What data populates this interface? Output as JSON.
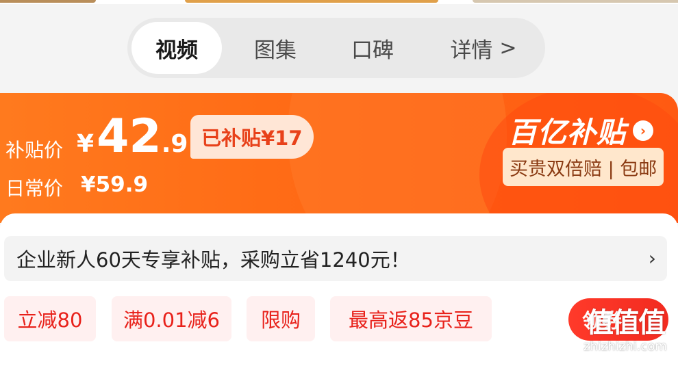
{
  "tabs": [
    {
      "label": "视频",
      "active": true
    },
    {
      "label": "图集",
      "active": false
    },
    {
      "label": "口碑",
      "active": false
    },
    {
      "label": "详情",
      "active": false
    }
  ],
  "tab_more_icon": "chevron-right-icon",
  "price_banner": {
    "subsidy_label": "补贴价",
    "currency": "¥",
    "price_integer": "42",
    "price_decimal": ".9",
    "subsidy_tag": "已补贴¥17",
    "daily_label": "日常价",
    "daily_price": "¥59.9",
    "brand": "百亿补贴",
    "guarantee": "买贵双倍赔 | 包邮",
    "colors": {
      "start": "#ff7a1e",
      "end": "#ff5a12"
    }
  },
  "promo": {
    "text": "企业新人60天专享补贴，采购立省1240元！",
    "icon": "chevron-right-icon"
  },
  "chips": [
    {
      "label": "立减80"
    },
    {
      "label": "满0.01减6"
    },
    {
      "label": "限购"
    },
    {
      "label": "最高返85京豆"
    }
  ],
  "coupon_button": "领券",
  "watermark": {
    "logo": "值值值",
    "url": "zhizhizhi.com"
  }
}
